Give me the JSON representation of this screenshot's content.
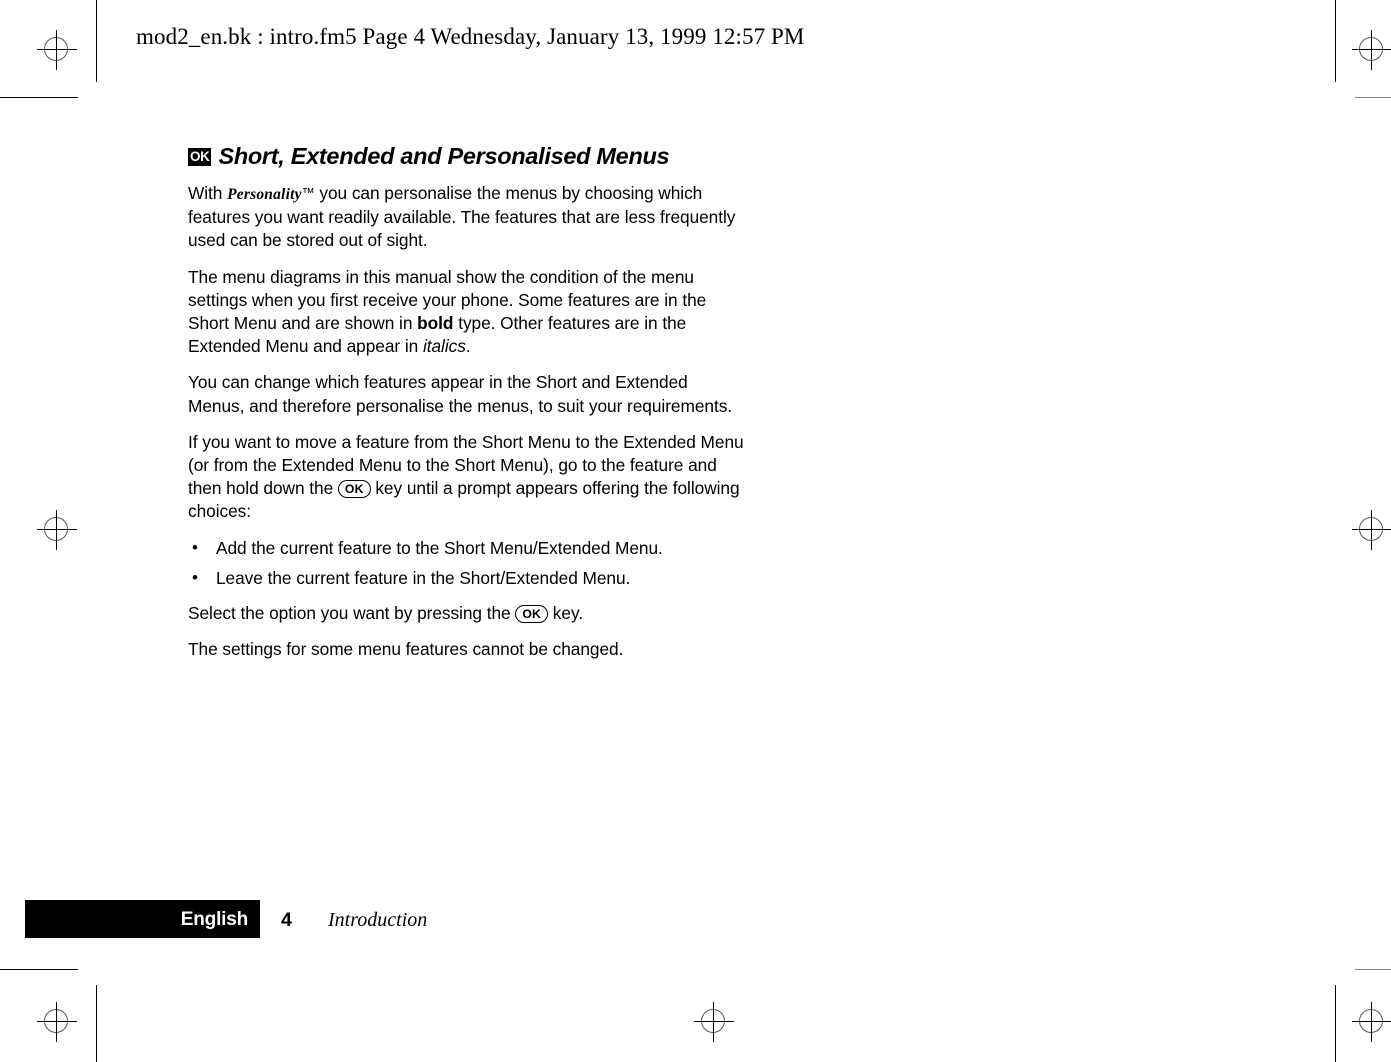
{
  "page": {
    "file_header": "mod2_en.bk : intro.fm5  Page 4  Wednesday, January 13, 1999  12:57 PM"
  },
  "section": {
    "badge_label": "OK",
    "title": "Short, Extended and Personalised Menus"
  },
  "paragraphs": {
    "p1_part1": "With ",
    "p1_brand": "Personality",
    "p1_tm": "™",
    "p1_part2": " you can personalise the menus by choosing which features you want readily available. The features that are less frequently used can be stored out of sight.",
    "p2_part1": "The menu diagrams in this manual show the condition of the menu settings when you first receive your phone. Some features are in the Short Menu and are shown in ",
    "p2_bold": "bold",
    "p2_part2": " type. Other features are in the Extended Menu and appear in ",
    "p2_italic": "italics",
    "p2_part3": ".",
    "p3": "You can change which features appear in the Short and Extended Menus, and therefore personalise the menus, to suit your requirements.",
    "p4_part1": "If you want to move a feature from the Short Menu to the Extended Menu (or from the Extended Menu to the Short Menu), go to the feature and then hold down the ",
    "p4_key": "OK",
    "p4_part2": " key until a prompt appears offering the following choices:",
    "p5_part1": "Select the option you want by pressing the ",
    "p5_key": "OK",
    "p5_part2": " key.",
    "p6": "The settings for some menu features cannot be changed."
  },
  "choices": {
    "bullet_glyph": "•",
    "items": [
      "Add the current feature to the Short Menu/Extended Menu.",
      "Leave the current feature in the Short/Extended Menu."
    ]
  },
  "footer": {
    "language": "English",
    "page_number": "4",
    "section_name": "Introduction"
  }
}
